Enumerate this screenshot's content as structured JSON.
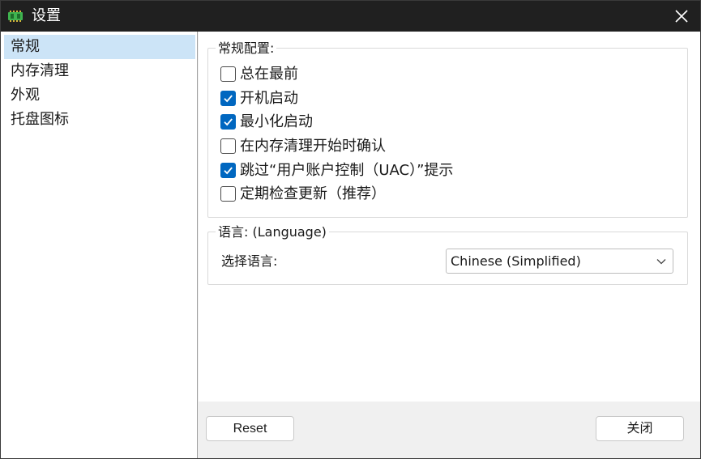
{
  "window": {
    "title": "设置",
    "app_icon": "memory-chip-icon",
    "close_icon": "close-icon"
  },
  "sidebar": {
    "items": [
      {
        "label": "常规",
        "selected": true
      },
      {
        "label": "内存清理",
        "selected": false
      },
      {
        "label": "外观",
        "selected": false
      },
      {
        "label": "托盘图标",
        "selected": false
      }
    ]
  },
  "general": {
    "group_title": "常规配置:",
    "options": [
      {
        "label": "总在最前",
        "checked": false
      },
      {
        "label": "开机启动",
        "checked": true
      },
      {
        "label": "最小化启动",
        "checked": true
      },
      {
        "label": "在内存清理开始时确认",
        "checked": false
      },
      {
        "label": "跳过“用户账户控制（UAC）”提示",
        "checked": true
      },
      {
        "label": "定期检查更新（推荐）",
        "checked": false
      }
    ]
  },
  "language": {
    "group_title": "语言: (Language)",
    "label": "选择语言:",
    "selected": "Chinese (Simplified)"
  },
  "footer": {
    "reset_label": "Reset",
    "close_label": "关闭"
  },
  "colors": {
    "accent": "#0067c0",
    "selection": "#cce4f7",
    "titlebar": "#202020"
  }
}
